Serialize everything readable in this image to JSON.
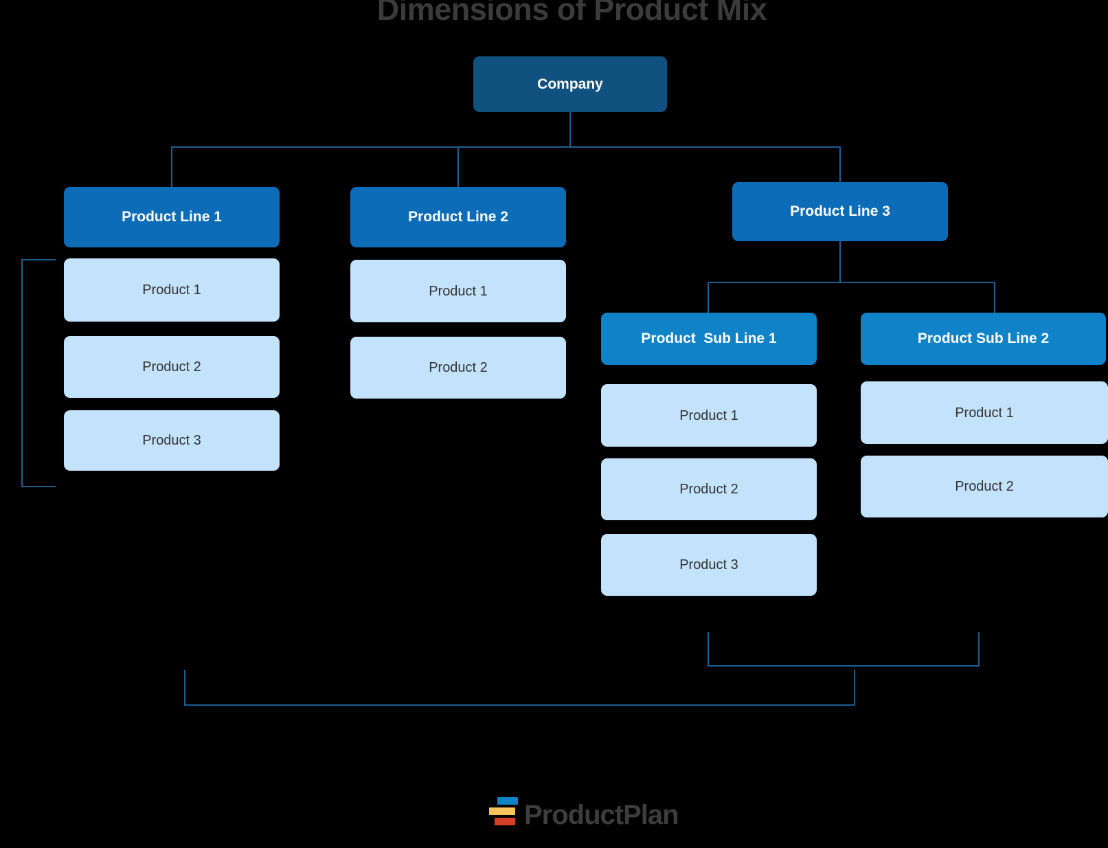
{
  "title": "Dimensions of Product Mix",
  "nodes": {
    "company": "Company",
    "line1": "Product Line 1",
    "line2": "Product Line 2",
    "line3": "Product Line 3",
    "subline1": "Product  Sub Line 1",
    "subline2": "Product Sub Line 2"
  },
  "columns": {
    "line1_products": [
      "Product 1",
      "Product 2",
      "Product 3"
    ],
    "line2_products": [
      "Product 1",
      "Product 2"
    ],
    "subline1_products": [
      "Product 1",
      "Product 2",
      "Product 3"
    ],
    "subline2_products": [
      "Product 1",
      "Product 2"
    ]
  },
  "logo": {
    "text": "ProductPlan",
    "bar_colors": [
      "#1183c2",
      "#f7c35c",
      "#d3412a"
    ]
  },
  "colors": {
    "background": "#000000",
    "title": "#3b3b3b",
    "company_box": "#11517f",
    "line_box": "#0d6cb8",
    "subline_box": "#0f82c8",
    "product_box": "#c3e2fb",
    "product_text": "#333333",
    "connector": "#1b5f93"
  }
}
